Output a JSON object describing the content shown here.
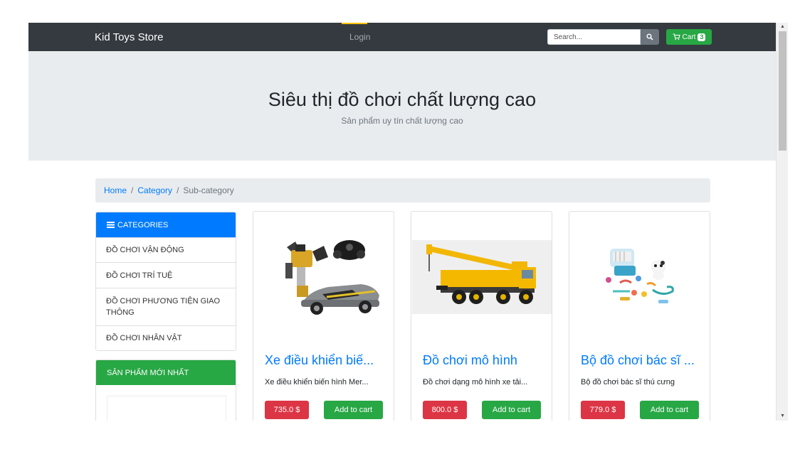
{
  "navbar": {
    "brand": "Kid Toys Store",
    "login": "Login",
    "search_placeholder": "Search...",
    "cart_label": "Cart",
    "cart_count": "3",
    "search_icon": "search-icon",
    "cart_icon": "cart-icon"
  },
  "hero": {
    "title": "Siêu thị đồ chơi chất lượng cao",
    "subtitle": "Sản phẩm uy tín chất lượng cao"
  },
  "breadcrumb": {
    "home": "Home",
    "category": "Category",
    "current": "Sub-category"
  },
  "categories": {
    "header": "CATEGORIES",
    "icon": "list-icon",
    "items": [
      {
        "label": "ĐỒ CHƠI VẬN ĐỘNG"
      },
      {
        "label": "ĐỒ CHƠI TRÍ TUỆ"
      },
      {
        "label": "ĐỒ CHƠI PHƯƠNG TIỆN GIAO THÔNG"
      },
      {
        "label": "ĐỒ CHƠI NHÂN VẬT"
      }
    ]
  },
  "new_products": {
    "header": "SẢN PHẨM MỚI NHẤT"
  },
  "products": [
    {
      "title": "Xe điều khiển biế...",
      "description": "Xe điều khiển biến hình Mer...",
      "price": "735.0 $",
      "add_label": "Add to cart",
      "image": "transforming-robot-car"
    },
    {
      "title": "Đồ chơi mô hình",
      "description": "Đồ chơi dạng mô hình xe tải...",
      "price": "800.0 $",
      "add_label": "Add to cart",
      "image": "crane-truck"
    },
    {
      "title": "Bộ đồ chơi bác sĩ ...",
      "description": "Bộ đồ chơi bác sĩ thú cưng",
      "price": "779.0 $",
      "add_label": "Add to cart",
      "image": "pet-doctor-set"
    }
  ],
  "colors": {
    "navbar": "#343a40",
    "primary": "#007bff",
    "success": "#28a745",
    "danger": "#dc3545",
    "jumbotron": "#e9ecef"
  }
}
